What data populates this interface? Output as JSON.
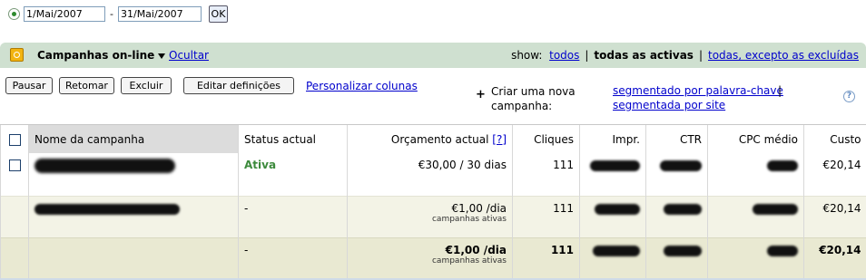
{
  "date_range": {
    "start": "1/Mai/2007",
    "separator": "-",
    "end": "31/Mai/2007",
    "ok_label": "OK"
  },
  "campaigns_header": {
    "title": "Campanhas on-line",
    "hide_link": "Ocultar",
    "show_label": "show:",
    "show_all": "todos",
    "show_active": "todas as activas",
    "show_except_deleted": "todas, excepto as excluídas"
  },
  "toolbar": {
    "pause": "Pausar",
    "resume": "Retomar",
    "delete": "Excluir",
    "edit_settings": "Editar definições",
    "customize_columns": "Personalizar colunas",
    "create_plus": "+",
    "create_text": "Criar uma nova campanha:",
    "by_keyword": "segmentado por palavra-chave",
    "pipe": "|",
    "by_site": "segmentada por site",
    "help": "?"
  },
  "table": {
    "headers": {
      "name": "Nome da campanha",
      "status": "Status actual",
      "budget": "Orçamento actual",
      "budget_help": "[?]",
      "clicks": "Cliques",
      "impr": "Impr.",
      "ctr": "CTR",
      "cpc": "CPC médio",
      "cost": "Custo"
    },
    "row1": {
      "status": "Ativa",
      "budget": "€30,00 / 30 dias",
      "clicks": "111",
      "cost": "€20,14"
    },
    "row2": {
      "status": "-",
      "budget": "€1,00 /dia",
      "budget_sub": "campanhas ativas",
      "clicks": "111",
      "cost": "€20,14"
    },
    "row3": {
      "status": "-",
      "budget": "€1,00 /dia",
      "budget_sub": "campanhas ativas",
      "clicks": "111",
      "cost": "€20,14"
    }
  }
}
